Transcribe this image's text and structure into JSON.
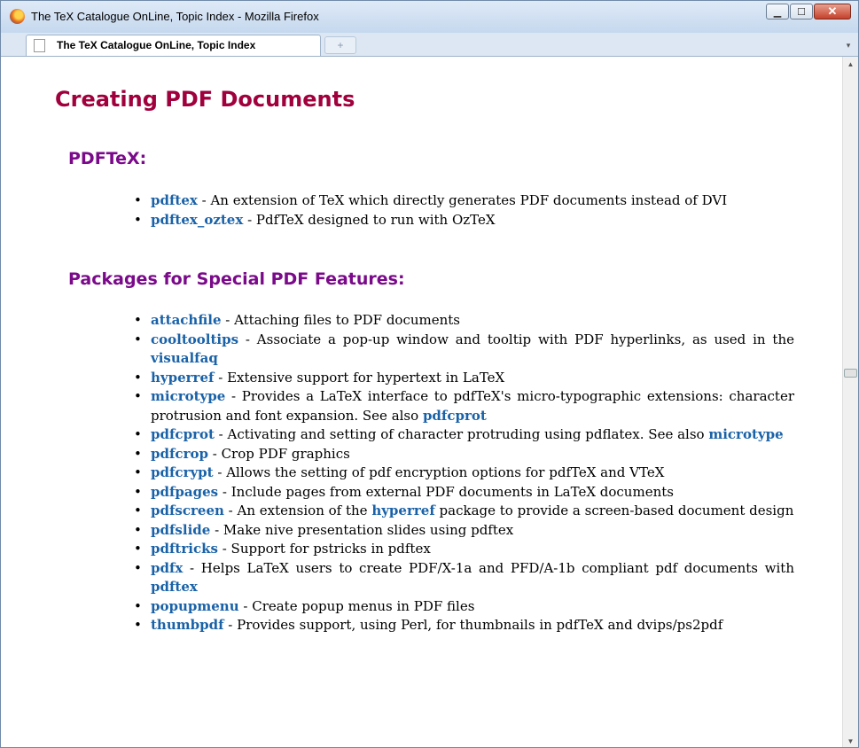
{
  "window": {
    "title": "The TeX Catalogue OnLine, Topic Index - Mozilla Firefox",
    "minimize_label": "▁",
    "maximize_label": "☐",
    "close_label": "✕"
  },
  "tabs": [
    {
      "label": "The TeX Catalogue OnLine, Topic Index"
    }
  ],
  "newtab_label": "+",
  "tablist_label": "▾",
  "scroll": {
    "up_label": "▲",
    "down_label": "▼"
  },
  "page": {
    "heading": "Creating PDF Documents",
    "sections": [
      {
        "title": "PDFTeX:",
        "items": [
          {
            "link": "pdftex",
            "desc": " - An extension of TeX which directly generates PDF documents instead of DVI"
          },
          {
            "link": "pdftex_oztex",
            "desc": " - PdfTeX designed to run with OzTeX"
          }
        ]
      },
      {
        "title": "Packages for Special PDF Features:",
        "items": [
          {
            "link": "attachfile",
            "desc": " - Attaching files to PDF documents"
          },
          {
            "link": "cooltooltips",
            "desc": " - Associate a pop-up window and tooltip with PDF hyperlinks, as used in the ",
            "link2": "visualfaq",
            "desc2": ""
          },
          {
            "link": "hyperref",
            "desc": " - Extensive support for hypertext in LaTeX"
          },
          {
            "link": "microtype",
            "desc": " - Provides a LaTeX interface to pdfTeX's micro-typographic extensions: character protrusion and font expansion. See also ",
            "link2": "pdfcprot",
            "desc2": ""
          },
          {
            "link": "pdfcprot",
            "desc": " - Activating and setting of character protruding using pdflatex. See also ",
            "link2": "microtype",
            "desc2": ""
          },
          {
            "link": "pdfcrop",
            "desc": " - Crop PDF graphics"
          },
          {
            "link": "pdfcrypt",
            "desc": " - Allows the setting of pdf encryption options for pdfTeX and VTeX"
          },
          {
            "link": "pdfpages",
            "desc": " - Include pages from external PDF documents in LaTeX documents"
          },
          {
            "link": "pdfscreen",
            "desc": " - An extension of the ",
            "link2": "hyperref",
            "desc2": " package to provide a screen-based document design"
          },
          {
            "link": "pdfslide",
            "desc": " - Make nive presentation slides using pdftex"
          },
          {
            "link": "pdftricks",
            "desc": " - Support for pstricks in pdftex"
          },
          {
            "link": "pdfx",
            "desc": " - Helps LaTeX users to create PDF/X-1a and PFD/A-1b compliant pdf documents with ",
            "link2": "pdftex",
            "desc2": ""
          },
          {
            "link": "popupmenu",
            "desc": " - Create popup menus in PDF files"
          },
          {
            "link": "thumbpdf",
            "desc": " - Provides support, using Perl, for thumbnails in pdfTeX and dvips/ps2pdf"
          }
        ]
      }
    ]
  }
}
